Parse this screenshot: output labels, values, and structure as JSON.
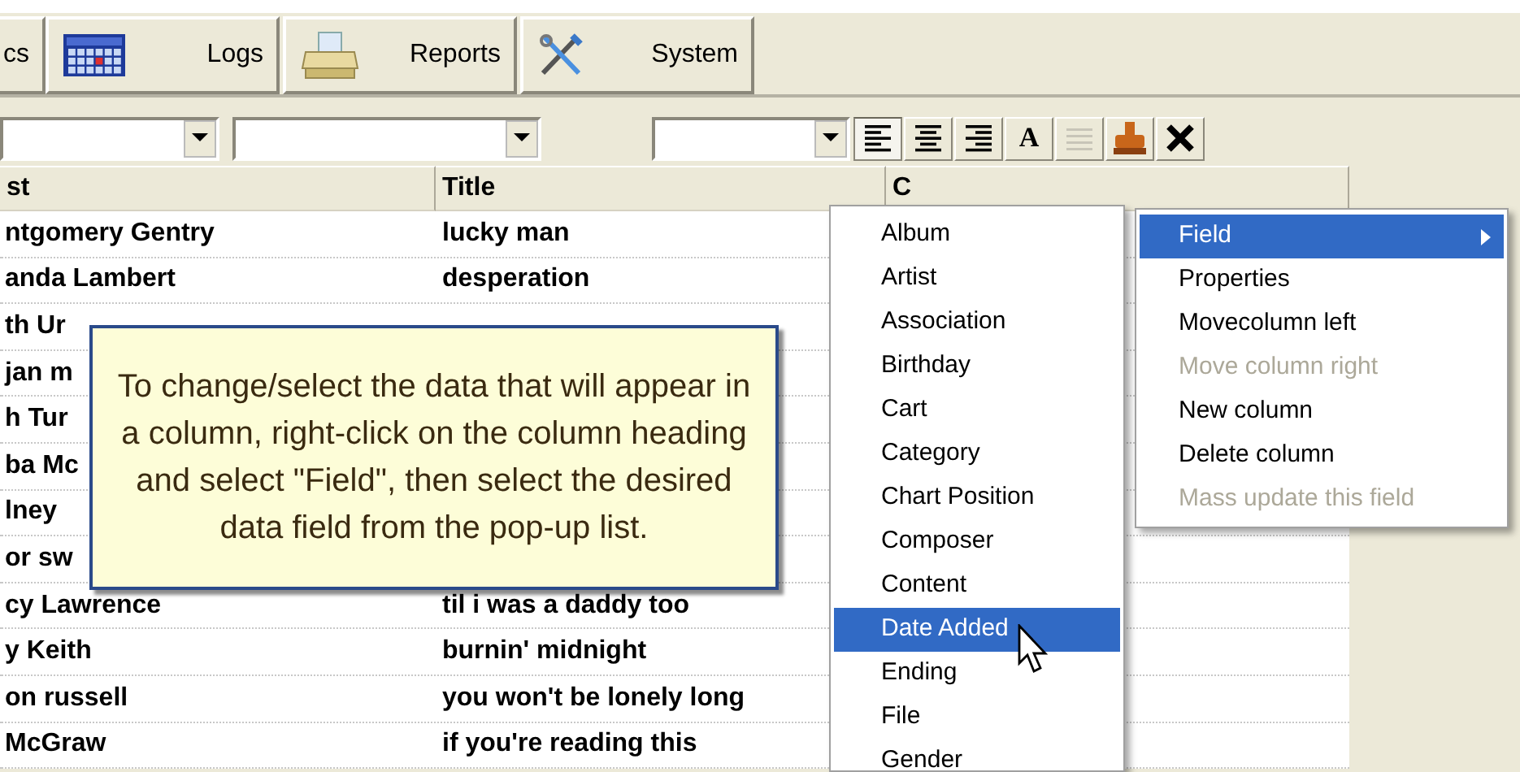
{
  "toolbar": {
    "buttons": [
      {
        "label": "cs"
      },
      {
        "label": "Logs"
      },
      {
        "label": "Reports"
      },
      {
        "label": "System"
      }
    ]
  },
  "format_buttons": [
    {
      "kind": "align-left",
      "selected": true
    },
    {
      "kind": "align-center",
      "selected": false
    },
    {
      "kind": "align-right",
      "selected": false
    },
    {
      "kind": "letter",
      "label": "A"
    },
    {
      "kind": "lines",
      "disabled": true
    },
    {
      "kind": "stamp"
    },
    {
      "kind": "delete"
    }
  ],
  "table": {
    "columns": [
      "st",
      "Title",
      "C"
    ],
    "rows": [
      {
        "column_1": "ntgomery Gentry",
        "title": "lucky man"
      },
      {
        "column_1": "anda Lambert",
        "title": "desperation"
      },
      {
        "column_1": "th Ur"
      },
      {
        "column_1": "jan m"
      },
      {
        "column_1": "h Tur"
      },
      {
        "column_1": "ba Mc"
      },
      {
        "column_1": "lney"
      },
      {
        "column_1": "or sw"
      },
      {
        "column_1": "cy Lawrence",
        "title": "til i was a daddy too"
      },
      {
        "column_1": "y Keith",
        "title": "burnin' midnight"
      },
      {
        "column_1": "on russell",
        "title": "you won't be lonely long"
      },
      {
        "column_1": "McGraw",
        "title": "if you're reading this"
      }
    ]
  },
  "tooltip": "To change/select the data that will appear in a column, right-click on the column heading and select \"Field\", then select the desired data field from the pop-up list.",
  "field_menu": {
    "items": [
      {
        "label": "Album",
        "selected": false
      },
      {
        "label": "Artist",
        "selected": false
      },
      {
        "label": "Association",
        "selected": false
      },
      {
        "label": "Birthday",
        "selected": false
      },
      {
        "label": "Cart",
        "selected": false
      },
      {
        "label": "Category",
        "selected": false
      },
      {
        "label": "Chart Position",
        "selected": false
      },
      {
        "label": "Composer",
        "selected": false
      },
      {
        "label": "Content",
        "selected": false
      },
      {
        "label": "Date Added",
        "selected": true
      },
      {
        "label": "Ending",
        "selected": false
      },
      {
        "label": "File",
        "selected": false
      },
      {
        "label": "Gender",
        "selected": false
      }
    ]
  },
  "context_menu": {
    "items": [
      {
        "label": "Field",
        "selected": true,
        "disabled": false,
        "submenu": true
      },
      {
        "label": "Properties",
        "selected": false,
        "disabled": false,
        "submenu": false
      },
      {
        "label": "Movecolumn left",
        "selected": false,
        "disabled": false,
        "submenu": false
      },
      {
        "label": "Move column right",
        "selected": false,
        "disabled": true,
        "submenu": false
      },
      {
        "label": "New column",
        "selected": false,
        "disabled": false,
        "submenu": false
      },
      {
        "label": "Delete column",
        "selected": false,
        "disabled": false,
        "submenu": false
      },
      {
        "label": "Mass update this field",
        "selected": false,
        "disabled": true,
        "submenu": false
      }
    ]
  }
}
